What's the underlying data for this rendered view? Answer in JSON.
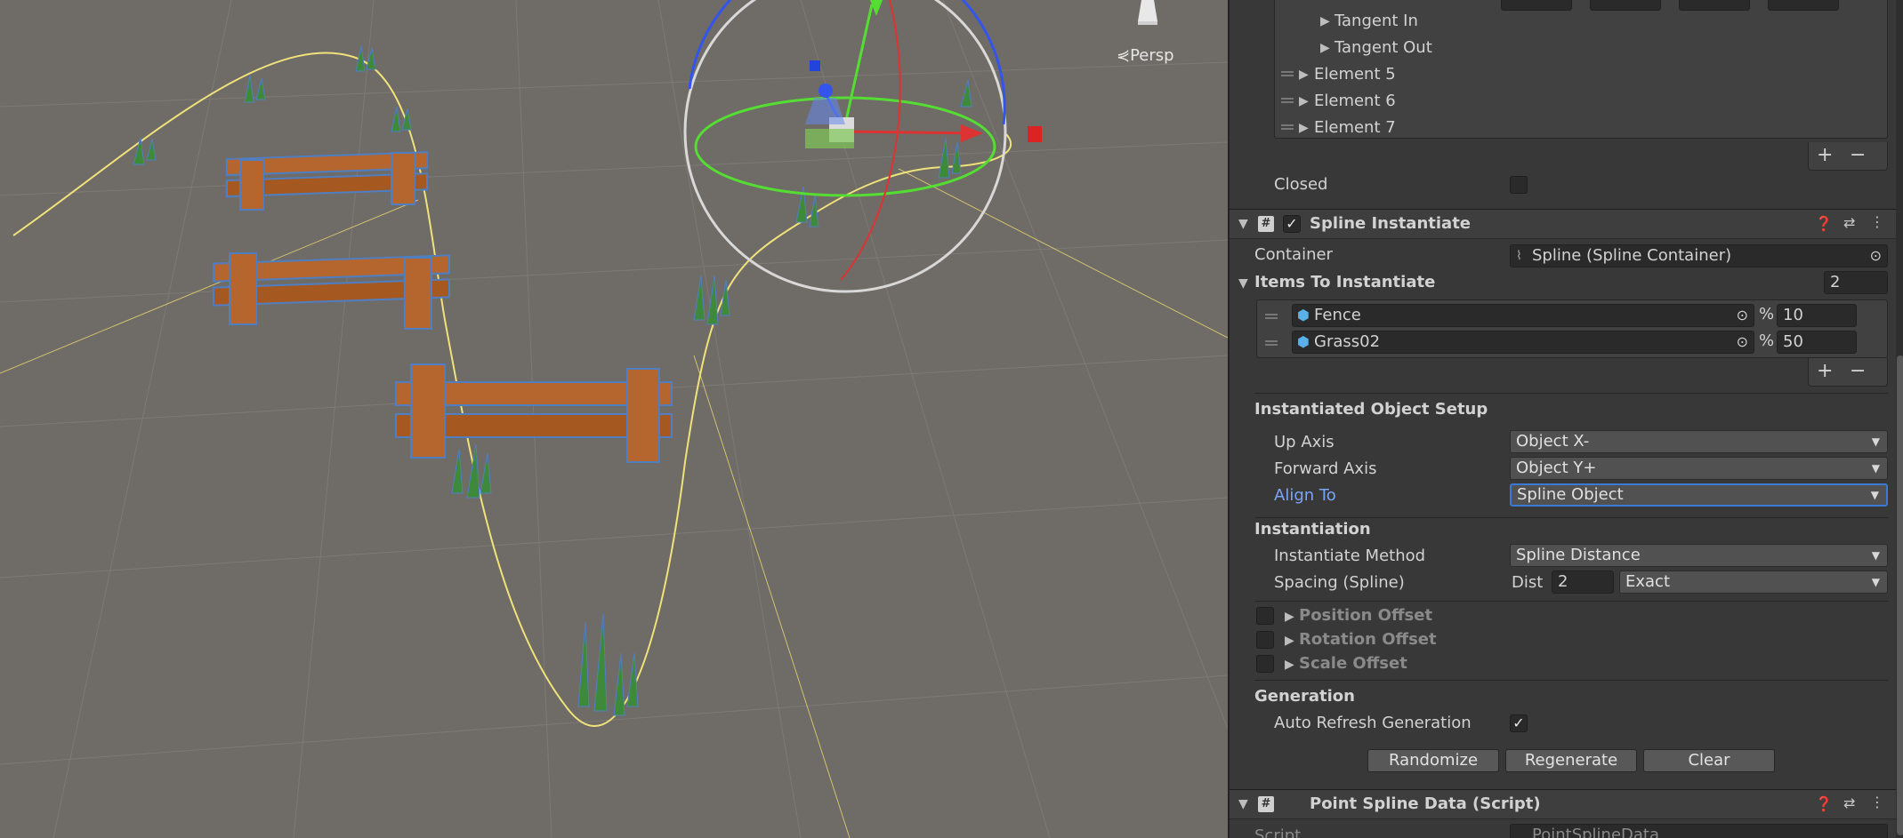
{
  "viewport": {
    "persp_label": "⋞Persp"
  },
  "inspector": {
    "tangent_in": "Tangent In",
    "tangent_out": "Tangent Out",
    "elements": [
      "Element 5",
      "Element 6",
      "Element 7"
    ],
    "closed_label": "Closed",
    "spline_instantiate": {
      "title": "Spline Instantiate",
      "container_label": "Container",
      "container_value": "Spline (Spline Container)",
      "items_label": "Items To Instantiate",
      "items_count": "2",
      "items": [
        {
          "name": "Fence",
          "percent_sign": "%",
          "value": "10"
        },
        {
          "name": "Grass02",
          "percent_sign": "%",
          "value": "50"
        }
      ],
      "setup_header": "Instantiated Object Setup",
      "up_axis_label": "Up Axis",
      "up_axis_value": "Object X-",
      "forward_axis_label": "Forward Axis",
      "forward_axis_value": "Object Y+",
      "align_to_label": "Align To",
      "align_to_value": "Spline Object",
      "instantiation_header": "Instantiation",
      "method_label": "Instantiate Method",
      "method_value": "Spline Distance",
      "spacing_label": "Spacing (Spline)",
      "dist_label": "Dist",
      "dist_value": "2",
      "spacing_mode": "Exact",
      "position_offset": "Position Offset",
      "rotation_offset": "Rotation Offset",
      "scale_offset": "Scale Offset",
      "generation_header": "Generation",
      "auto_refresh_label": "Auto Refresh Generation",
      "randomize": "Randomize",
      "regenerate": "Regenerate",
      "clear": "Clear"
    },
    "point_spline": {
      "title": "Point Spline Data (Script)",
      "script_label": "Script",
      "script_value": "PointSplineData"
    }
  },
  "colors": {
    "scene_bg": "#6f6b66",
    "spline": "#f0e27a",
    "fence": "#b5652e",
    "grass": "#3f8a3a",
    "selection_outline": "#4f7fc2",
    "focus_blue": "#3a79d6"
  }
}
